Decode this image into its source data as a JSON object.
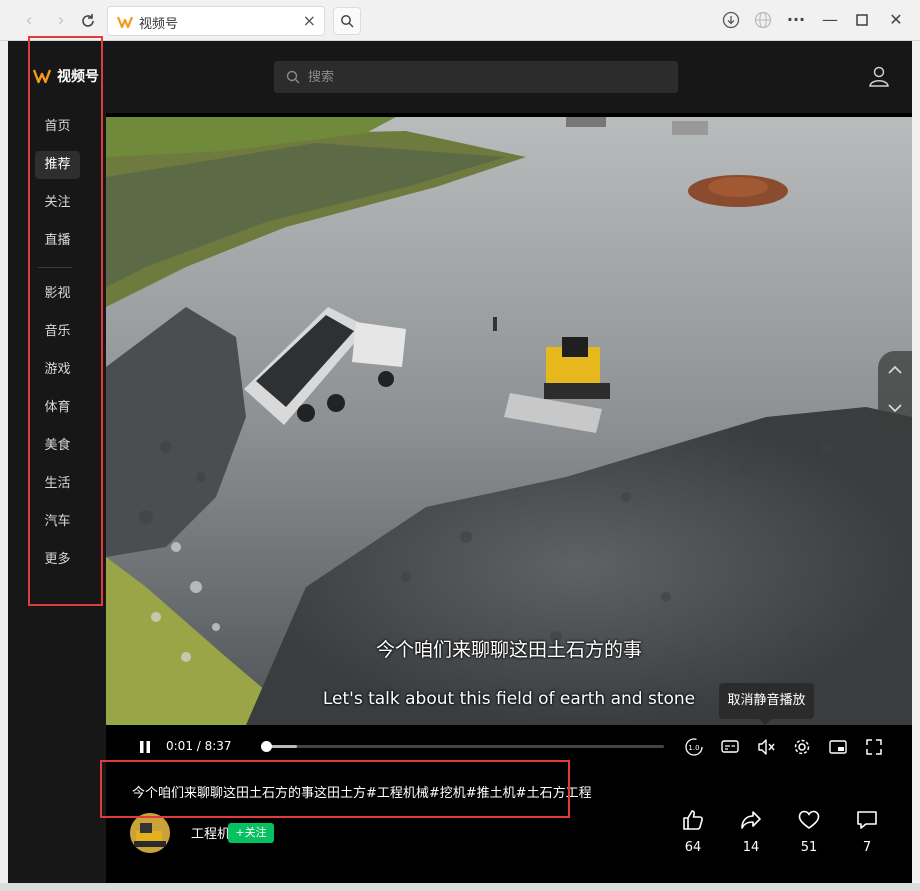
{
  "browser": {
    "tab_title": "视频号",
    "controls": {
      "back_icon": "chevron-left-icon",
      "forward_icon": "chevron-right-icon",
      "reload_icon": "reload-icon",
      "search_icon": "search-icon",
      "download_icon": "download-icon",
      "globe_icon": "globe-icon",
      "menu_icon": "more-icon"
    }
  },
  "brand": {
    "name": "视频号",
    "accent": "#f59a1c"
  },
  "sidebar": {
    "items": [
      {
        "label": "首页"
      },
      {
        "label": "推荐"
      },
      {
        "label": "关注"
      },
      {
        "label": "直播"
      },
      {
        "label": "影视"
      },
      {
        "label": "音乐"
      },
      {
        "label": "游戏"
      },
      {
        "label": "体育"
      },
      {
        "label": "美食"
      },
      {
        "label": "生活"
      },
      {
        "label": "汽车"
      },
      {
        "label": "更多"
      }
    ],
    "active_index": 1
  },
  "search": {
    "placeholder": "搜索"
  },
  "video": {
    "subtitle_cn": "今个咱们来聊聊这田土石方的事",
    "subtitle_en": "Let's talk about this field of earth and stone",
    "time_current": "0:01",
    "time_total": "8:37",
    "time_display": "0:01 / 8:37",
    "progress_fraction": 0.002,
    "tooltip": "取消静音播放",
    "speed_label": "1.0"
  },
  "post": {
    "description": "今个咱们来聊聊这田土石方的事这田土方#工程机械#挖机#推土机#土石方工程",
    "author_name": "工程机械",
    "follow_label": "+关注"
  },
  "actions": {
    "likes": "64",
    "shares": "14",
    "favorites": "51",
    "comments": "7"
  }
}
